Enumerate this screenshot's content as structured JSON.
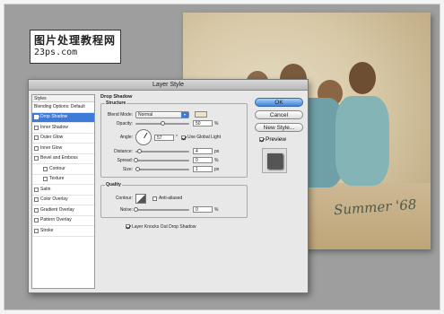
{
  "watermark": {
    "line1": "图片处理教程网",
    "line2": "23ps.com"
  },
  "photo": {
    "caption": "Summer '68"
  },
  "dialog": {
    "title": "Layer Style",
    "styles_header": "Styles",
    "styles": [
      {
        "label": "Blending Options: Default",
        "checkbox": false,
        "checked": false,
        "selected": false,
        "indent": false
      },
      {
        "label": "Drop Shadow",
        "checkbox": true,
        "checked": true,
        "selected": true,
        "indent": false
      },
      {
        "label": "Inner Shadow",
        "checkbox": true,
        "checked": false,
        "selected": false,
        "indent": false
      },
      {
        "label": "Outer Glow",
        "checkbox": true,
        "checked": false,
        "selected": false,
        "indent": false
      },
      {
        "label": "Inner Glow",
        "checkbox": true,
        "checked": false,
        "selected": false,
        "indent": false
      },
      {
        "label": "Bevel and Emboss",
        "checkbox": true,
        "checked": false,
        "selected": false,
        "indent": false
      },
      {
        "label": "Contour",
        "checkbox": true,
        "checked": false,
        "selected": false,
        "indent": true
      },
      {
        "label": "Texture",
        "checkbox": true,
        "checked": false,
        "selected": false,
        "indent": true
      },
      {
        "label": "Satin",
        "checkbox": true,
        "checked": false,
        "selected": false,
        "indent": false
      },
      {
        "label": "Color Overlay",
        "checkbox": true,
        "checked": false,
        "selected": false,
        "indent": false
      },
      {
        "label": "Gradient Overlay",
        "checkbox": true,
        "checked": false,
        "selected": false,
        "indent": false
      },
      {
        "label": "Pattern Overlay",
        "checkbox": true,
        "checked": false,
        "selected": false,
        "indent": false
      },
      {
        "label": "Stroke",
        "checkbox": true,
        "checked": false,
        "selected": false,
        "indent": false
      }
    ],
    "panel": {
      "title": "Drop Shadow",
      "structure": {
        "legend": "Structure",
        "blend_mode_label": "Blend Mode:",
        "blend_mode_value": "Normal",
        "shadow_color": "#f1e2c3",
        "opacity_label": "Opacity:",
        "opacity_value": "50",
        "opacity_unit": "%",
        "angle_label": "Angle:",
        "angle_value": "57",
        "angle_unit": "°",
        "global_light_label": "Use Global Light",
        "distance_label": "Distance:",
        "distance_value": "4",
        "distance_unit": "px",
        "spread_label": "Spread:",
        "spread_value": "0",
        "spread_unit": "%",
        "size_label": "Size:",
        "size_value": "1",
        "size_unit": "px"
      },
      "quality": {
        "legend": "Quality",
        "contour_label": "Contour:",
        "anti_aliased_label": "Anti-aliased",
        "noise_label": "Noise:",
        "noise_value": "0",
        "noise_unit": "%"
      },
      "knockout_label": "Layer Knocks Out Drop Shadow"
    },
    "buttons": {
      "ok": "OK",
      "cancel": "Cancel",
      "new_style": "New Style..."
    },
    "preview_label": "Preview"
  }
}
